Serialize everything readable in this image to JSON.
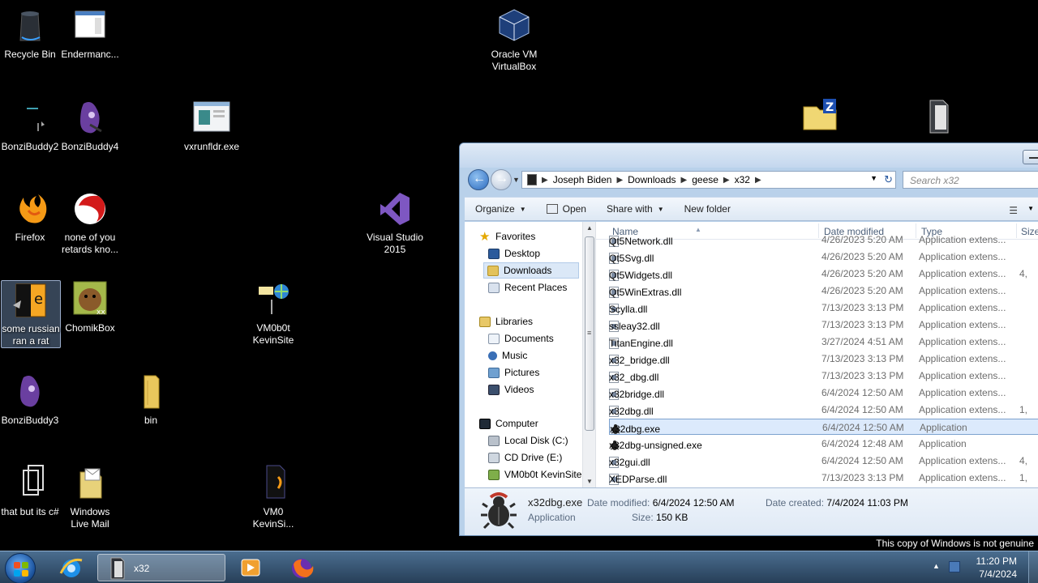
{
  "desktop": {
    "icons": [
      {
        "label": "Recycle Bin"
      },
      {
        "label": "Endermanc..."
      },
      {
        "label": "Oracle VM VirtualBox"
      },
      {
        "label": "BonziBuddy2"
      },
      {
        "label": "BonziBuddy4"
      },
      {
        "label": "vxrunfldr.exe"
      },
      {
        "label": "Firefox"
      },
      {
        "label": "none of you retards kno..."
      },
      {
        "label": "Visual Studio 2015"
      },
      {
        "label": "some russian ran a rat"
      },
      {
        "label": "ChomikBox"
      },
      {
        "label": "VM0b0t KevinSite"
      },
      {
        "label": "BonziBuddy3"
      },
      {
        "label": "bin"
      },
      {
        "label": "that but its c#"
      },
      {
        "label": "Windows Live Mail"
      },
      {
        "label": "VM0 KevinSi..."
      }
    ],
    "watermark": "This copy of Windows is not genuine"
  },
  "explorer": {
    "breadcrumb": [
      "Joseph Biden",
      "Downloads",
      "geese",
      "x32"
    ],
    "search_placeholder": "Search x32",
    "toolbar": {
      "organize": "Organize",
      "open": "Open",
      "share_with": "Share with",
      "new_folder": "New folder"
    },
    "nav": {
      "favorites": "Favorites",
      "desktop": "Desktop",
      "downloads": "Downloads",
      "recent": "Recent Places",
      "libraries": "Libraries",
      "documents": "Documents",
      "music": "Music",
      "pictures": "Pictures",
      "videos": "Videos",
      "computer": "Computer",
      "local_disk": "Local Disk (C:)",
      "cd_drive": "CD Drive (E:)",
      "network": "VM0b0t KevinSite"
    },
    "columns": {
      "name": "Name",
      "date": "Date modified",
      "type": "Type",
      "size": "Size"
    },
    "files": [
      {
        "name": "Qt5Network.dll",
        "date": "4/26/2023 5:20 AM",
        "type": "Application extens...",
        "size": ""
      },
      {
        "name": "Qt5Svg.dll",
        "date": "4/26/2023 5:20 AM",
        "type": "Application extens...",
        "size": ""
      },
      {
        "name": "Qt5Widgets.dll",
        "date": "4/26/2023 5:20 AM",
        "type": "Application extens...",
        "size": "4,"
      },
      {
        "name": "Qt5WinExtras.dll",
        "date": "4/26/2023 5:20 AM",
        "type": "Application extens...",
        "size": ""
      },
      {
        "name": "Scylla.dll",
        "date": "7/13/2023 3:13 PM",
        "type": "Application extens...",
        "size": ""
      },
      {
        "name": "ssleay32.dll",
        "date": "7/13/2023 3:13 PM",
        "type": "Application extens...",
        "size": ""
      },
      {
        "name": "TitanEngine.dll",
        "date": "3/27/2024 4:51 AM",
        "type": "Application extens...",
        "size": ""
      },
      {
        "name": "x32_bridge.dll",
        "date": "7/13/2023 3:13 PM",
        "type": "Application extens...",
        "size": ""
      },
      {
        "name": "x32_dbg.dll",
        "date": "7/13/2023 3:13 PM",
        "type": "Application extens...",
        "size": ""
      },
      {
        "name": "x32bridge.dll",
        "date": "6/4/2024 12:50 AM",
        "type": "Application extens...",
        "size": ""
      },
      {
        "name": "x32dbg.dll",
        "date": "6/4/2024 12:50 AM",
        "type": "Application extens...",
        "size": "1,"
      },
      {
        "name": "x32dbg.exe",
        "date": "6/4/2024 12:50 AM",
        "type": "Application",
        "size": ""
      },
      {
        "name": "x32dbg-unsigned.exe",
        "date": "6/4/2024 12:48 AM",
        "type": "Application",
        "size": ""
      },
      {
        "name": "x32gui.dll",
        "date": "6/4/2024 12:50 AM",
        "type": "Application extens...",
        "size": "4,"
      },
      {
        "name": "XEDParse.dll",
        "date": "7/13/2023 3:13 PM",
        "type": "Application extens...",
        "size": "1,"
      }
    ],
    "details": {
      "name": "x32dbg.exe",
      "type": "Application",
      "modified_label": "Date modified:",
      "modified_value": "6/4/2024 12:50 AM",
      "size_label": "Size:",
      "size_value": "150 KB",
      "created_label": "Date created:",
      "created_value": "7/4/2024 11:03 PM"
    }
  },
  "taskbar": {
    "active_window": "x32",
    "time": "11:20 PM",
    "date": "7/4/2024"
  }
}
